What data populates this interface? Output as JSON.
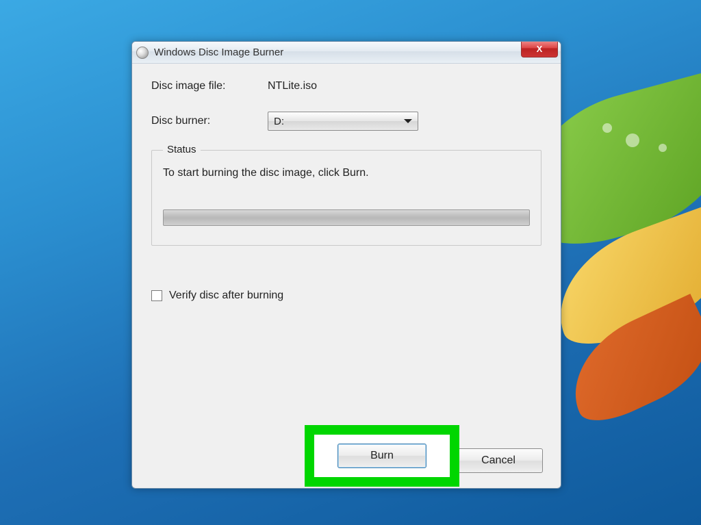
{
  "window": {
    "title": "Windows Disc Image Burner",
    "close_label": "X"
  },
  "form": {
    "disc_image_label": "Disc image file:",
    "disc_image_value": "NTLite.iso",
    "disc_burner_label": "Disc burner:",
    "disc_burner_value": "D:"
  },
  "status": {
    "legend": "Status",
    "message": "To start burning the disc image, click Burn."
  },
  "verify": {
    "label": "Verify disc after burning"
  },
  "buttons": {
    "burn": "Burn",
    "cancel": "Cancel"
  }
}
